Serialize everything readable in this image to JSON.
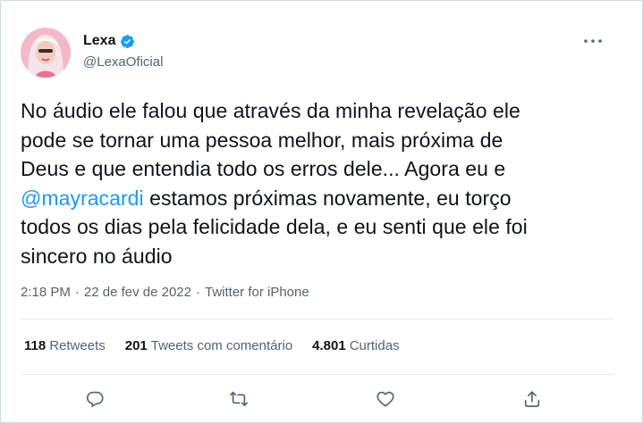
{
  "author": {
    "display_name": "Lexa",
    "handle": "@LexaOficial",
    "verified": true,
    "verified_color": "#1d9bf0"
  },
  "tweet": {
    "lines": [
      "No áudio ele falou que através da minha revelação ele",
      "pode se tornar uma pessoa melhor, mais próxima de",
      "Deus e que entendia todo os erros dele... Agora eu e"
    ],
    "mention": "@mayracardi",
    "line4_rest": " estamos próximas novamente, eu torço",
    "lines_after": [
      "todos os dias pela felicidade dela, e eu senti que ele foi",
      "sincero no áudio"
    ]
  },
  "meta": {
    "time": "2:18 PM",
    "separator": "·",
    "date": "22 de fev de 2022",
    "source": "Twitter for iPhone"
  },
  "stats": {
    "retweets_count": "118",
    "retweets_label": "Retweets",
    "quotes_count": "201",
    "quotes_label": "Tweets com comentário",
    "likes_count": "4.801",
    "likes_label": "Curtidas"
  },
  "actions": {
    "reply_icon": "reply-icon",
    "retweet_icon": "retweet-icon",
    "like_icon": "like-icon",
    "share_icon": "share-icon"
  },
  "colors": {
    "text": "#0f1419",
    "secondary": "#536471",
    "accent": "#1d9bf0",
    "border": "#cfd9de"
  }
}
